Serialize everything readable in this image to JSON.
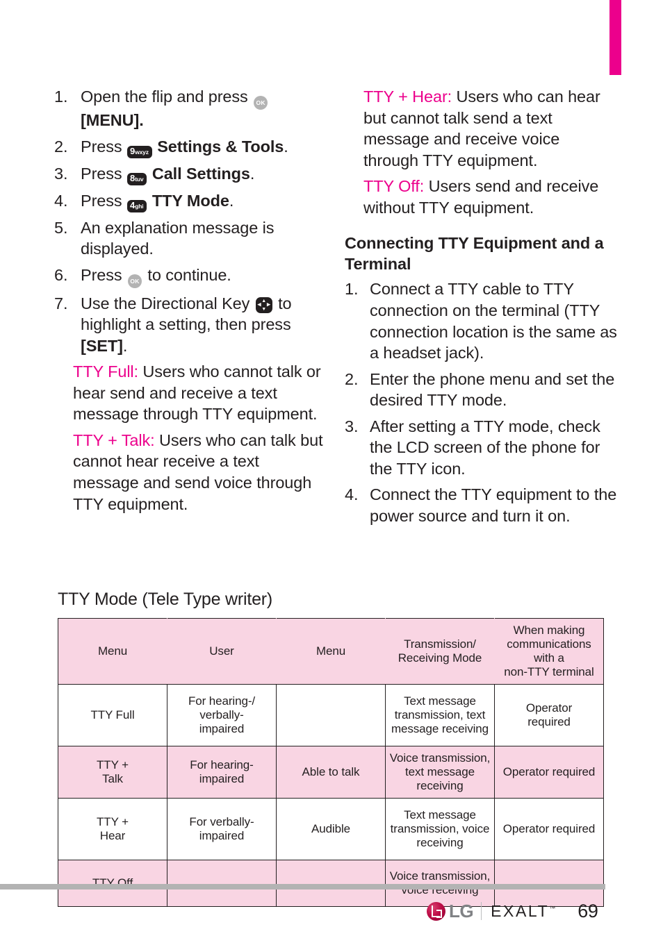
{
  "page": {
    "number": "69",
    "edge_tab_color": "#ec008c",
    "accent_color": "#ec008c",
    "table_shade_color": "#f9d5e3"
  },
  "left_column": {
    "steps": [
      {
        "num": "1.",
        "pre": "Open the flip and press ",
        "icon": "ok-key-icon",
        "icon_label": "OK",
        "post": "",
        "bold_after": "",
        "second_line": "[MENU]."
      },
      {
        "num": "2.",
        "pre": "Press ",
        "icon": "keypad-key-9-icon",
        "key_digit": "9",
        "key_letters": "wxyz",
        "post": "",
        "bold_after": "Settings & Tools",
        "trail": "."
      },
      {
        "num": "3.",
        "pre": "Press ",
        "icon": "keypad-key-8-icon",
        "key_digit": "8",
        "key_letters": "tuv",
        "post": "",
        "bold_after": "Call Settings",
        "trail": "."
      },
      {
        "num": "4.",
        "pre": "Press ",
        "icon": "keypad-key-4-icon",
        "key_digit": "4",
        "key_letters": "ghi",
        "post": "",
        "bold_after": "TTY Mode",
        "trail": "."
      },
      {
        "num": "5.",
        "pre": "An explanation message is displayed.",
        "icon": "",
        "post": ""
      },
      {
        "num": "6.",
        "pre": "Press ",
        "icon": "ok-key-icon",
        "icon_label": "OK",
        "post": " to continue."
      },
      {
        "num": "7.",
        "pre": "Use the Directional Key ",
        "icon": "directional-key-icon",
        "post": " to highlight a setting, then press ",
        "bold_after": "[SET]",
        "trail": "."
      }
    ],
    "definitions": [
      {
        "term": "TTY Full:",
        "text": " Users who cannot talk or hear send and receive a text message through TTY equipment."
      },
      {
        "term": "TTY + Talk:",
        "text": " Users who can talk but cannot hear receive a text message and send voice through TTY equipment."
      }
    ]
  },
  "right_column": {
    "definitions": [
      {
        "term": "TTY + Hear:",
        "text": " Users who can hear but cannot talk send a text message and receive voice through TTY equipment."
      },
      {
        "term": "TTY Off:",
        "text": " Users send and receive without TTY equipment."
      }
    ],
    "heading": "Connecting TTY Equipment and a Terminal",
    "steps": [
      {
        "num": "1.",
        "text": "Connect a TTY cable to TTY connection on the terminal (TTY connection location is the same as a headset jack)."
      },
      {
        "num": "2.",
        "text": "Enter the phone menu and set the desired TTY mode."
      },
      {
        "num": "3.",
        "text": "After setting a TTY mode, check the LCD screen of the phone for the TTY icon."
      },
      {
        "num": "4.",
        "text": "Connect the TTY equipment to the power source and turn it on."
      }
    ]
  },
  "table": {
    "title": "TTY Mode (Tele Type writer)",
    "headers": [
      "Menu",
      "User",
      "Menu",
      "Transmission/\nReceiving Mode",
      "When making\ncommunications with a\nnon-TTY terminal"
    ],
    "rows": [
      {
        "shaded": false,
        "cells": [
          "TTY Full",
          "For hearing-/\nverbally-\nimpaired",
          "",
          "Text message\ntransmission, text\nmessage receiving",
          "Operator\nrequired"
        ]
      },
      {
        "shaded": true,
        "cells": [
          "TTY +\nTalk",
          "For hearing-\nimpaired",
          "Able to talk",
          "Voice transmission,\ntext message receiving",
          "Operator required"
        ]
      },
      {
        "shaded": false,
        "cells": [
          "TTY +\nHear",
          "For verbally-\nimpaired",
          "Audible",
          "Text message\ntransmission, voice\nreceiving",
          "Operator required"
        ]
      },
      {
        "shaded": true,
        "cells": [
          "TTY Off",
          "",
          "",
          "Voice transmission,\nvoice receiving",
          ""
        ]
      }
    ]
  },
  "footer": {
    "brand": "LG",
    "product": "EXALT",
    "trademark": "™",
    "page_number": "69"
  }
}
